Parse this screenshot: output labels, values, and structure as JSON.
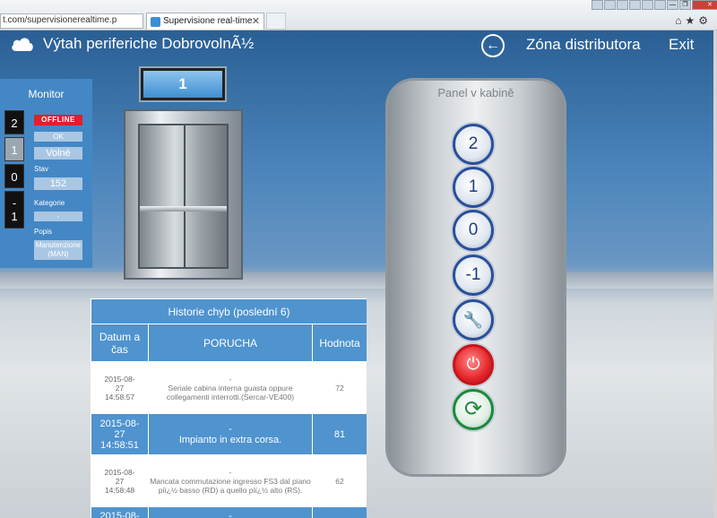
{
  "browser": {
    "url": "t.com/supervisionerealtime.p",
    "tab_title": "Supervisione real-time",
    "tab_close": "✕",
    "window_buttons": [
      "",
      "",
      "",
      "",
      "",
      "",
      "—",
      "❐",
      "✕"
    ],
    "toolbar_icons": "⌂★⚙"
  },
  "header": {
    "title": "Výtah  periferiche  DobrovolnÃ½",
    "back_icon": "arrow-left-icon",
    "zone_link": "Zóna distributora",
    "exit_link": "Exit"
  },
  "floor_indicator": {
    "value": "1"
  },
  "monitor": {
    "title": "Monitor",
    "floors": [
      {
        "label": "2",
        "active": false
      },
      {
        "label": "1",
        "active": true
      },
      {
        "label": "0",
        "active": false
      },
      {
        "label": "-\n1",
        "active": false
      }
    ],
    "status_badge": "OFFLINE",
    "ok_value": "OK",
    "state_value": "Volné",
    "stav_label": "Stav",
    "stav_value": "152",
    "kategorie_label": "Kategorie",
    "kategorie_value": "-",
    "popis_label": "Popis",
    "popis_value": "Manutenzione (MAN)"
  },
  "cabin_panel": {
    "title": "Panel v kabině",
    "buttons": [
      {
        "label": "2",
        "name": "floor-2-button"
      },
      {
        "label": "1",
        "name": "floor-1-button"
      },
      {
        "label": "0",
        "name": "floor-0-button"
      },
      {
        "label": "-1",
        "name": "floor-minus1-button"
      },
      {
        "label": "🔧",
        "name": "maintenance-tools-icon"
      },
      {
        "label": "⏻",
        "name": "power-icon"
      },
      {
        "label": "⟳",
        "name": "refresh-icon"
      }
    ]
  },
  "history": {
    "title": "Historie chyb (poslední 6)",
    "columns": [
      "Datum a čas",
      "PORUCHA",
      "Hodnota"
    ],
    "rows": [
      {
        "date": "2015-08-\n27\n14:58:57",
        "fault": "-\nSeriale cabina interna guasta oppure collegamenti interrotti.(Sercar-VE400)",
        "value": "72",
        "style": "white"
      },
      {
        "date": "2015-08-\n27\n14:58:51",
        "fault": "-\nImpianto in extra corsa.",
        "value": "81",
        "style": "blue"
      },
      {
        "date": "2015-08-\n27\n14:58:48",
        "fault": "-\nMancata commutazione ingresso FS3 dal piano piï¿½ basso (RD) a quello piï¿½ alto (RS).",
        "value": "62",
        "style": "white"
      },
      {
        "date": "2015-08-",
        "fault": "-",
        "value": "",
        "style": "blue"
      }
    ]
  },
  "colors": {
    "header_blue": "#2a5f94",
    "monitor_blue": "#4487c5",
    "table_blue": "#4f93cf",
    "offline_red": "#e0202a",
    "button_ring": "#2a4f9a"
  }
}
